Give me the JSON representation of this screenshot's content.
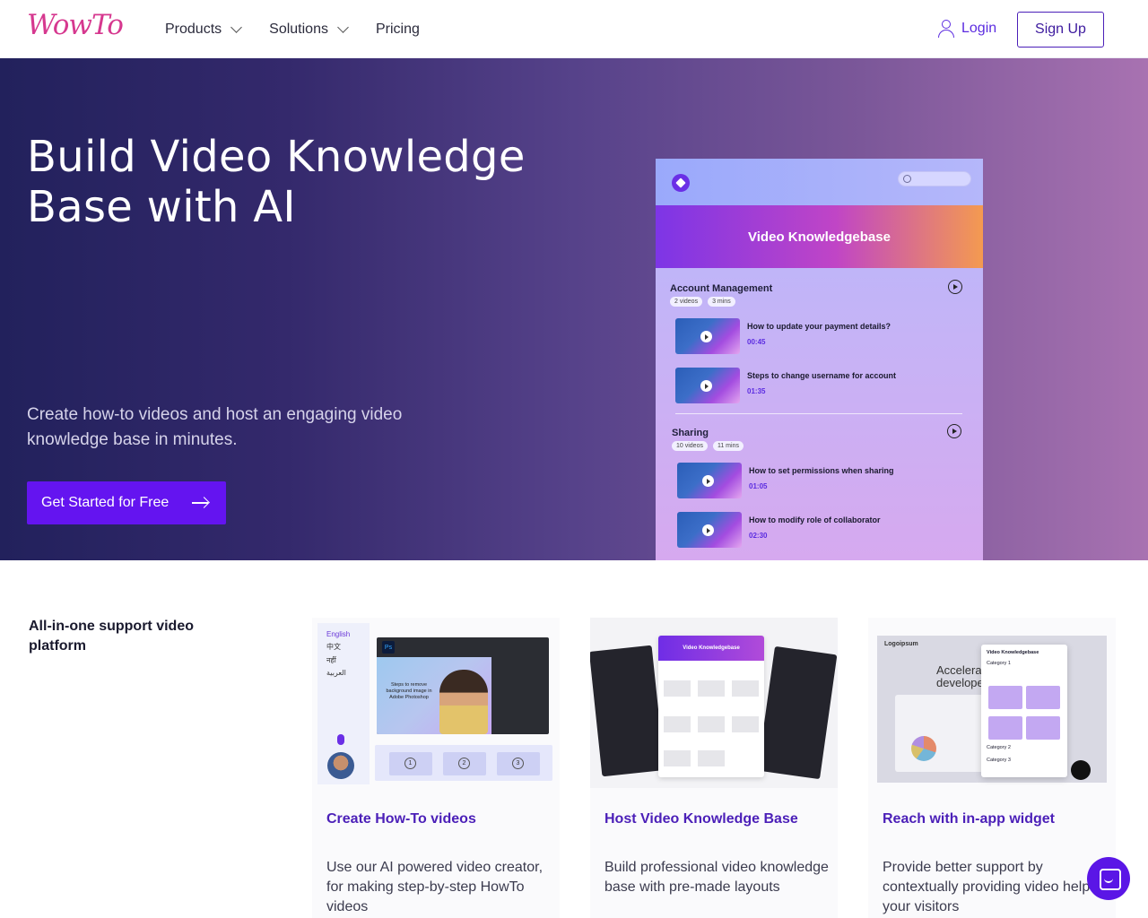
{
  "nav": {
    "logo": "WowTo",
    "products": "Products",
    "solutions": "Solutions",
    "pricing": "Pricing",
    "login": "Login",
    "signup": "Sign Up"
  },
  "hero": {
    "title": "Build Video Knowledge Base with AI",
    "subtitle": "Create how-to videos and host an engaging video knowledge base in minutes.",
    "cta": "Get Started for Free"
  },
  "kb": {
    "banner": "Video Knowledgebase",
    "sections": [
      {
        "title": "Account Management",
        "videos_count": "2 videos",
        "duration": "3 mins",
        "items": [
          {
            "title": "How to update your payment details?",
            "time": "00:45"
          },
          {
            "title": "Steps to change username for account",
            "time": "01:35"
          }
        ]
      },
      {
        "title": "Sharing",
        "videos_count": "10 videos",
        "duration": "11 mins",
        "items": [
          {
            "title": "How to set permissions when sharing",
            "time": "01:05"
          },
          {
            "title": "How to modify role of collaborator",
            "time": "02:30"
          }
        ]
      }
    ]
  },
  "features": {
    "heading": "All-in-one support video platform",
    "cards": [
      {
        "title": "Create How-To videos",
        "desc": "Use our AI powered video creator, for making step-by-step HowTo videos",
        "art": {
          "languages": [
            "English",
            "中文",
            "नहीं",
            "العربية"
          ],
          "ps_badge": "Ps",
          "photo_text": "Steps to remove background image in Adobe Photoshop",
          "steps": [
            "1",
            "2",
            "3"
          ]
        }
      },
      {
        "title": "Host Video Knowledge Base",
        "desc": "Build professional video knowledge base with pre-made layouts",
        "art": {
          "bar": "Video Knowledgebase"
        }
      },
      {
        "title": "Reach with in-app widget",
        "desc": "Provide better support by contextually providing video help to your visitors",
        "art": {
          "brand": "Logoipsum",
          "headline": "Accelerate developer",
          "widget_title": "Video Knowledgebase",
          "categories": [
            "Category 1",
            "Category 2",
            "Category 3"
          ]
        }
      }
    ]
  },
  "colors": {
    "brand": "#6414f0",
    "accent_text": "#4b1fb8",
    "logo": "#d6388f"
  }
}
